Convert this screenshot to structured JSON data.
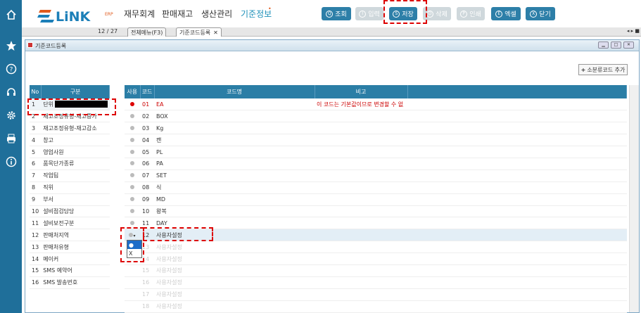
{
  "sidebar": {
    "icons": [
      "home-icon",
      "star-icon",
      "help-icon",
      "headset-icon",
      "gear-icon",
      "printer-icon",
      "info-icon"
    ]
  },
  "header": {
    "logo_text": "LiNK",
    "logo_sub": "ERP",
    "menu": [
      {
        "label": "재무회계"
      },
      {
        "label": "판매재고"
      },
      {
        "label": "생산관리"
      },
      {
        "label": "기준정보"
      }
    ],
    "toolbar": {
      "search": {
        "key": "Q",
        "label": "조회"
      },
      "insert": {
        "key": "I",
        "label": "입력"
      },
      "save": {
        "key": "S",
        "label": "저장"
      },
      "delete": {
        "key": "D",
        "label": "삭제"
      },
      "print": {
        "key": "P",
        "label": "인쇄"
      },
      "excel": {
        "key": "E",
        "label": "엑셀"
      },
      "close": {
        "key": "X",
        "label": "닫기"
      }
    }
  },
  "tabbar": {
    "page_count": "12 / 27",
    "tabs": [
      {
        "label": "전체메뉴(F3)"
      },
      {
        "label": "기준코드등록"
      }
    ]
  },
  "window": {
    "title": "기준코드등록",
    "add_button": "소분류코드 추가"
  },
  "left_table": {
    "headers": [
      "No",
      "구분"
    ],
    "rows": [
      {
        "no": "1",
        "name": "단위"
      },
      {
        "no": "2",
        "name": "재고조정유형-재고증가"
      },
      {
        "no": "3",
        "name": "재고조정유형-재고감소"
      },
      {
        "no": "4",
        "name": "창고"
      },
      {
        "no": "5",
        "name": "영업사원"
      },
      {
        "no": "6",
        "name": "품목단가종류"
      },
      {
        "no": "7",
        "name": "작업팀"
      },
      {
        "no": "8",
        "name": "직위"
      },
      {
        "no": "9",
        "name": "부서"
      },
      {
        "no": "10",
        "name": "설비점검담당"
      },
      {
        "no": "11",
        "name": "설비보전구분"
      },
      {
        "no": "12",
        "name": "판매처지역"
      },
      {
        "no": "13",
        "name": "판매처유형"
      },
      {
        "no": "14",
        "name": "메이커"
      },
      {
        "no": "15",
        "name": "SMS 예약어"
      },
      {
        "no": "16",
        "name": "SMS 발송번호"
      }
    ]
  },
  "right_table": {
    "headers": [
      "사용",
      "코드",
      "코드명",
      "비고"
    ],
    "rows": [
      {
        "code": "01",
        "name": "EA",
        "note": "이 코드는 기본값이므로 변경할 수 없",
        "use": "red"
      },
      {
        "code": "02",
        "name": "BOX",
        "note": "",
        "use": "gray"
      },
      {
        "code": "03",
        "name": "Kg",
        "note": "",
        "use": "gray"
      },
      {
        "code": "04",
        "name": "캔",
        "note": "",
        "use": "gray"
      },
      {
        "code": "05",
        "name": "PL",
        "note": "",
        "use": "gray"
      },
      {
        "code": "06",
        "name": "PA",
        "note": "",
        "use": "gray"
      },
      {
        "code": "07",
        "name": "SET",
        "note": "",
        "use": "gray"
      },
      {
        "code": "08",
        "name": "식",
        "note": "",
        "use": "gray"
      },
      {
        "code": "09",
        "name": "MD",
        "note": "",
        "use": "gray"
      },
      {
        "code": "10",
        "name": "왕복",
        "note": "",
        "use": "gray"
      },
      {
        "code": "11",
        "name": "DAY",
        "note": "",
        "use": "gray"
      },
      {
        "code": "12",
        "name": "사용자설정",
        "note": "",
        "use": "select"
      },
      {
        "code": "13",
        "name": "사용자설정",
        "note": "",
        "use": "faded"
      },
      {
        "code": "14",
        "name": "사용자설정",
        "note": "",
        "use": "faded"
      },
      {
        "code": "15",
        "name": "사용자설정",
        "note": "",
        "use": "faded"
      },
      {
        "code": "16",
        "name": "사용자설정",
        "note": "",
        "use": "faded"
      },
      {
        "code": "17",
        "name": "사용자설정",
        "note": "",
        "use": "faded"
      },
      {
        "code": "18",
        "name": "사용자설정",
        "note": "",
        "use": "faded"
      }
    ]
  },
  "dropdown": {
    "options": [
      "●",
      "X"
    ]
  }
}
